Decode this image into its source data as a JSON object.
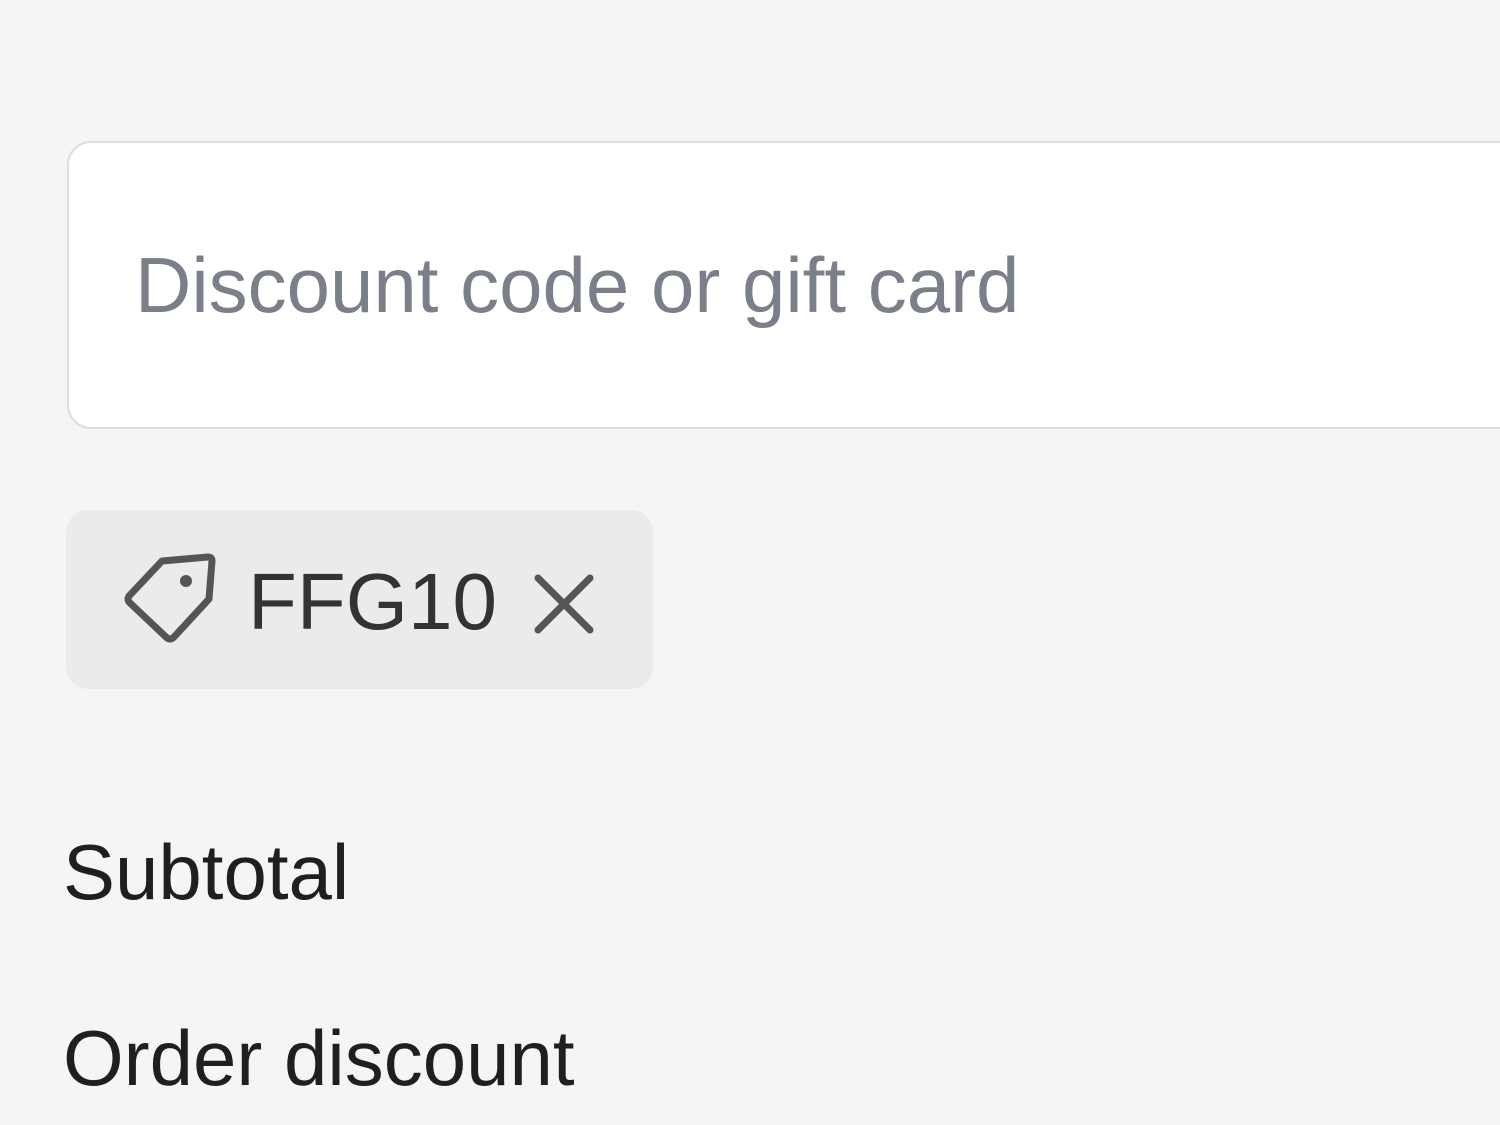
{
  "discount": {
    "placeholder": "Discount code or gift card",
    "value": ""
  },
  "applied_code": {
    "label": "FFG10",
    "icon": "tag-icon",
    "remove_icon": "close-icon"
  },
  "summary": {
    "subtotal_label": "Subtotal",
    "order_discount_label": "Order discount"
  },
  "colors": {
    "background": "#f5f5f5",
    "input_background": "#ffffff",
    "input_border": "#dedede",
    "placeholder": "#7a7f8a",
    "chip_background": "#ebebeb",
    "text": "#1f1f1f"
  }
}
